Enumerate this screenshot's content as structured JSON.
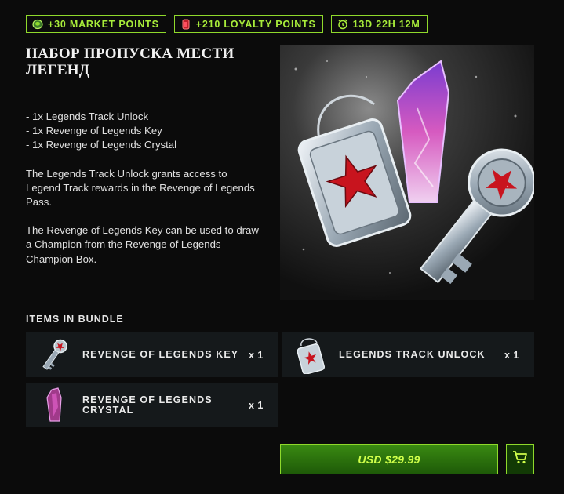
{
  "badges": {
    "market": "+30 MARKET POINTS",
    "loyalty": "+210 LOYALTY POINTS",
    "timer": "13D 22H 12M"
  },
  "title": "НАБОР ПРОПУСКА МЕСТИ ЛЕГЕНД",
  "description": {
    "list": [
      "- 1x Legends Track Unlock",
      "- 1x Revenge of Legends Key",
      "- 1x Revenge of Legends Crystal"
    ],
    "paragraphs": [
      "The Legends Track Unlock grants access to Legend Track rewards in the Revenge of Legends Pass.",
      "The Revenge of Legends Key can be used to draw a Champion from the Revenge of Legends Champion Box."
    ]
  },
  "items_label": "ITEMS IN BUNDLE",
  "items": [
    {
      "name": "REVENGE OF LEGENDS KEY",
      "qty": "x 1",
      "icon": "key-icon"
    },
    {
      "name": "LEGENDS TRACK UNLOCK",
      "qty": "x 1",
      "icon": "dogtag-icon"
    },
    {
      "name": "REVENGE OF LEGENDS CRYSTAL",
      "qty": "x 1",
      "icon": "crystal-icon"
    }
  ],
  "price": "USD $29.99",
  "colors": {
    "accent": "#8fd92b",
    "button": "#2e7a0f",
    "panel": "#15191b",
    "background": "#0b0b0b"
  }
}
